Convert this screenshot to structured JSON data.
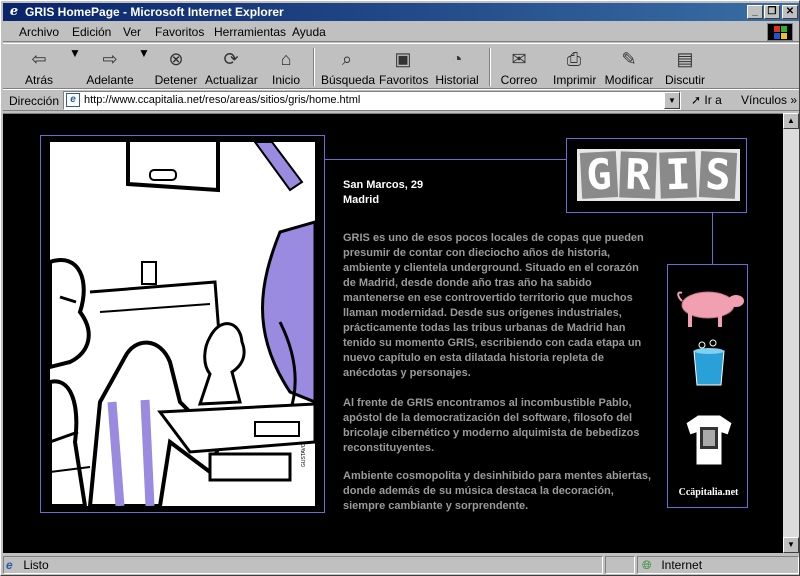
{
  "window": {
    "title": "GRIS HomePage - Microsoft Internet Explorer",
    "controls": {
      "minimize": "_",
      "maximize": "❐",
      "close": "✕"
    }
  },
  "menu": [
    "Archivo",
    "Edición",
    "Ver",
    "Favoritos",
    "Herramientas",
    "Ayuda"
  ],
  "toolbar": {
    "back": "Atrás",
    "forward": "Adelante",
    "stop": "Detener",
    "refresh": "Actualizar",
    "home": "Inicio",
    "search": "Búsqueda",
    "favorites": "Favoritos",
    "history": "Historial",
    "mail": "Correo",
    "print": "Imprimir",
    "edit": "Modificar",
    "discuss": "Discutir"
  },
  "address": {
    "label": "Dirección",
    "url": "http://www.ccapitalia.net/reso/areas/sitios/gris/home.html",
    "go": "Ir a",
    "links": "Vínculos"
  },
  "page": {
    "logo_letters": [
      "G",
      "R",
      "I",
      "S"
    ],
    "street": "San Marcos, 29",
    "city": "Madrid",
    "paragraphs": [
      [
        "GRIS es uno de esos pocos locales de  copas que pueden",
        "presumir de contar con dieciocho años de historia,",
        "ambiente y clientela underground. Situado en el corazón",
        "de Madrid, desde donde año tras año ha sabido",
        "mantenerse en ese controvertido territorio que muchos",
        "llaman modernidad. Desde sus orígenes industriales,",
        "prácticamente todas las tribus urbanas de Madrid han",
        "tenido su momento GRIS, escribiendo con cada etapa un",
        "nuevo capítulo en esta dilatada historia repleta de",
        "anécdotas y personajes."
      ],
      [
        "Al frente de GRIS encontramos al incombustible Pablo,",
        "apóstol de la democratización del software, filosofo del",
        "bricolaje cibernético y moderno alquimista de bebedizos",
        "reconstituyentes."
      ],
      [
        "Ambiente cosmopolita y desinhibido para mentes abiertas,",
        "donde además de su música destaca la decoración,",
        "siempre cambiante y sorprendente."
      ]
    ],
    "sidebar_caption": "Ccäpitalia.net",
    "illustration_signature": "GUSTAVO"
  },
  "status": {
    "text": "Listo",
    "zone": "Internet"
  },
  "colors": {
    "frame_border": "#6a6ad8",
    "text_grey": "#9a9a9a",
    "pig_pink": "#f0a0b0",
    "bucket_cyan": "#2aa0d8"
  }
}
